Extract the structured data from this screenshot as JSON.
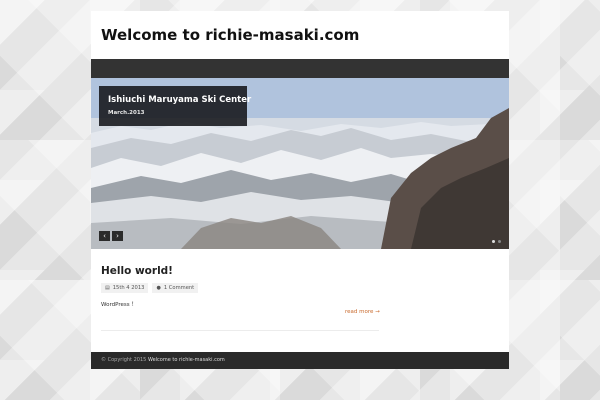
{
  "site": {
    "title": "Welcome to richie-masaki.com"
  },
  "slider": {
    "caption_title": "Ishiuchi Maruyama Ski Center",
    "caption_date": "March.2013",
    "prev_label": "‹",
    "next_label": "›",
    "slide_count": 2,
    "active_slide": 1
  },
  "post": {
    "title": "Hello world!",
    "date": "15th 4 2013",
    "comments": "1 Comment",
    "excerpt": "WordPress ！",
    "read_more": "read more →"
  },
  "footer": {
    "copyright": "© Copyright 2015",
    "site_name": "Welcome to richie-masaki.com"
  },
  "icons": {
    "calendar": "calendar-icon",
    "comment": "comment-icon"
  },
  "colors": {
    "accent": "#c96a2d",
    "nav": "#333333",
    "footer": "#2a2a2a"
  }
}
